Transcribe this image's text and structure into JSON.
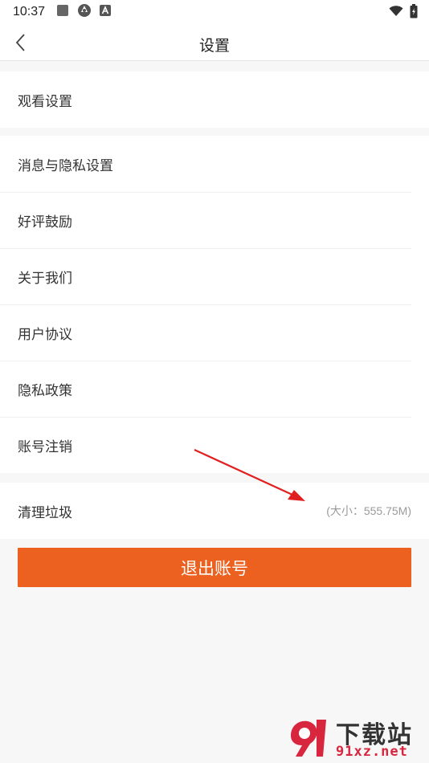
{
  "status_bar": {
    "time": "10:37",
    "icons": [
      "gallery-icon",
      "aperture-icon",
      "font-a-icon",
      "wifi-icon",
      "battery-icon"
    ]
  },
  "nav": {
    "back_icon": "chevron-left-icon",
    "title": "设置"
  },
  "groups": [
    {
      "items": [
        {
          "label": "观看设置"
        }
      ]
    },
    {
      "items": [
        {
          "label": "消息与隐私设置"
        },
        {
          "label": "好评鼓励"
        },
        {
          "label": "关于我们"
        },
        {
          "label": "用户协议"
        },
        {
          "label": "隐私政策"
        },
        {
          "label": "账号注销"
        }
      ]
    },
    {
      "items": [
        {
          "label": "清理垃圾",
          "value": "(大小：555.75M)"
        }
      ]
    }
  ],
  "logout_button": {
    "label": "退出账号"
  },
  "colors": {
    "accent": "#ec6120",
    "annotation_arrow": "#e02020",
    "background": "#f7f7f7"
  },
  "watermark": {
    "line1": "下载站",
    "line2": "91xz.net"
  }
}
